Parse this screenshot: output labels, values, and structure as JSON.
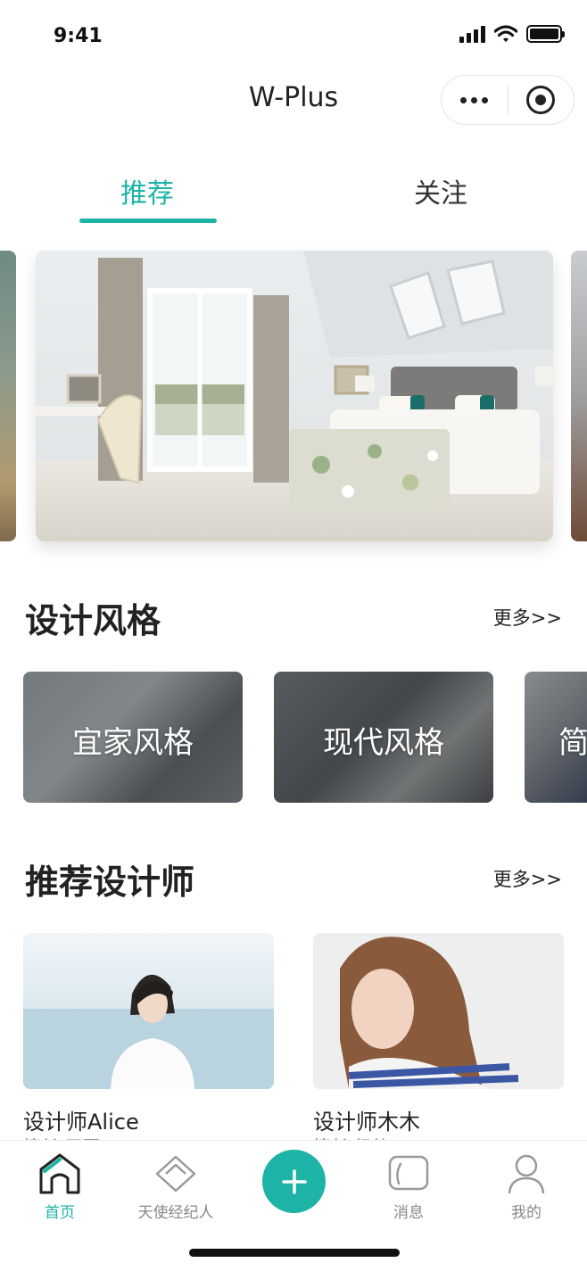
{
  "status_bar": {
    "time": "9:41"
  },
  "nav": {
    "title": "W-Plus"
  },
  "tabs": [
    {
      "label": "推荐",
      "active": true
    },
    {
      "label": "关注",
      "active": false
    }
  ],
  "accent_color": "#1db3a6",
  "banner": {
    "icon": "bedroom-photo"
  },
  "styles_section": {
    "title": "设计风格",
    "more": "更多>>",
    "cards": [
      {
        "label": "宜家风格"
      },
      {
        "label": "现代风格"
      },
      {
        "label": "简"
      }
    ]
  },
  "designers_section": {
    "title": "推荐设计师",
    "more": "更多>>",
    "designers": [
      {
        "name": "设计师Alice",
        "subtitle": "擅长 田园"
      },
      {
        "name": "设计师木木",
        "subtitle": "擅长 极简"
      }
    ]
  },
  "tabbar": {
    "items": [
      {
        "label": "首页",
        "icon": "home-icon",
        "active": true
      },
      {
        "label": "天使经纪人",
        "icon": "diamond-icon",
        "active": false
      },
      {
        "label": "",
        "icon": "add-icon",
        "active": false
      },
      {
        "label": "消息",
        "icon": "message-icon",
        "active": false
      },
      {
        "label": "我的",
        "icon": "profile-icon",
        "active": false
      }
    ]
  }
}
